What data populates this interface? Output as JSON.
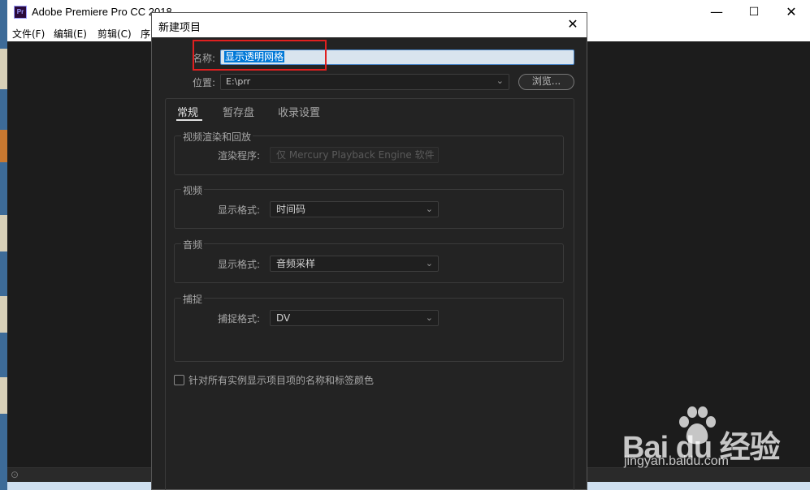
{
  "app": {
    "logo": "Pr",
    "title": "Adobe Premiere Pro CC 2018",
    "minimize": "—",
    "maximize": "☐",
    "close": "✕"
  },
  "menu": [
    "文件(F)",
    "编辑(E)",
    "剪辑(C)",
    "序"
  ],
  "dialog": {
    "title": "新建项目",
    "close": "✕",
    "name_label": "名称:",
    "name_value": "显示透明网格",
    "location_label": "位置:",
    "location_value": "E:\\prr",
    "browse_label": "浏览...",
    "tabs": [
      {
        "label": "常规",
        "active": true
      },
      {
        "label": "暂存盘",
        "active": false
      },
      {
        "label": "收录设置",
        "active": false
      }
    ],
    "groups": {
      "render": {
        "title": "视频渲染和回放",
        "field_label": "渲染程序:",
        "value": "仅 Mercury Playback Engine 软件",
        "disabled": true
      },
      "video": {
        "title": "视频",
        "field_label": "显示格式:",
        "value": "时间码"
      },
      "audio": {
        "title": "音频",
        "field_label": "显示格式:",
        "value": "音频采样"
      },
      "capture": {
        "title": "捕捉",
        "field_label": "捕捉格式:",
        "value": "DV"
      }
    },
    "checkbox_label": "针对所有实例显示项目项的名称和标签颜色",
    "checkbox_checked": false
  },
  "watermark": {
    "brand": "Bai du 经验",
    "url": "jingyan.baidu.com"
  },
  "colors": {
    "highlight_box": "#e02020",
    "selection": "#0078d7",
    "dialog_bg": "#232323"
  }
}
